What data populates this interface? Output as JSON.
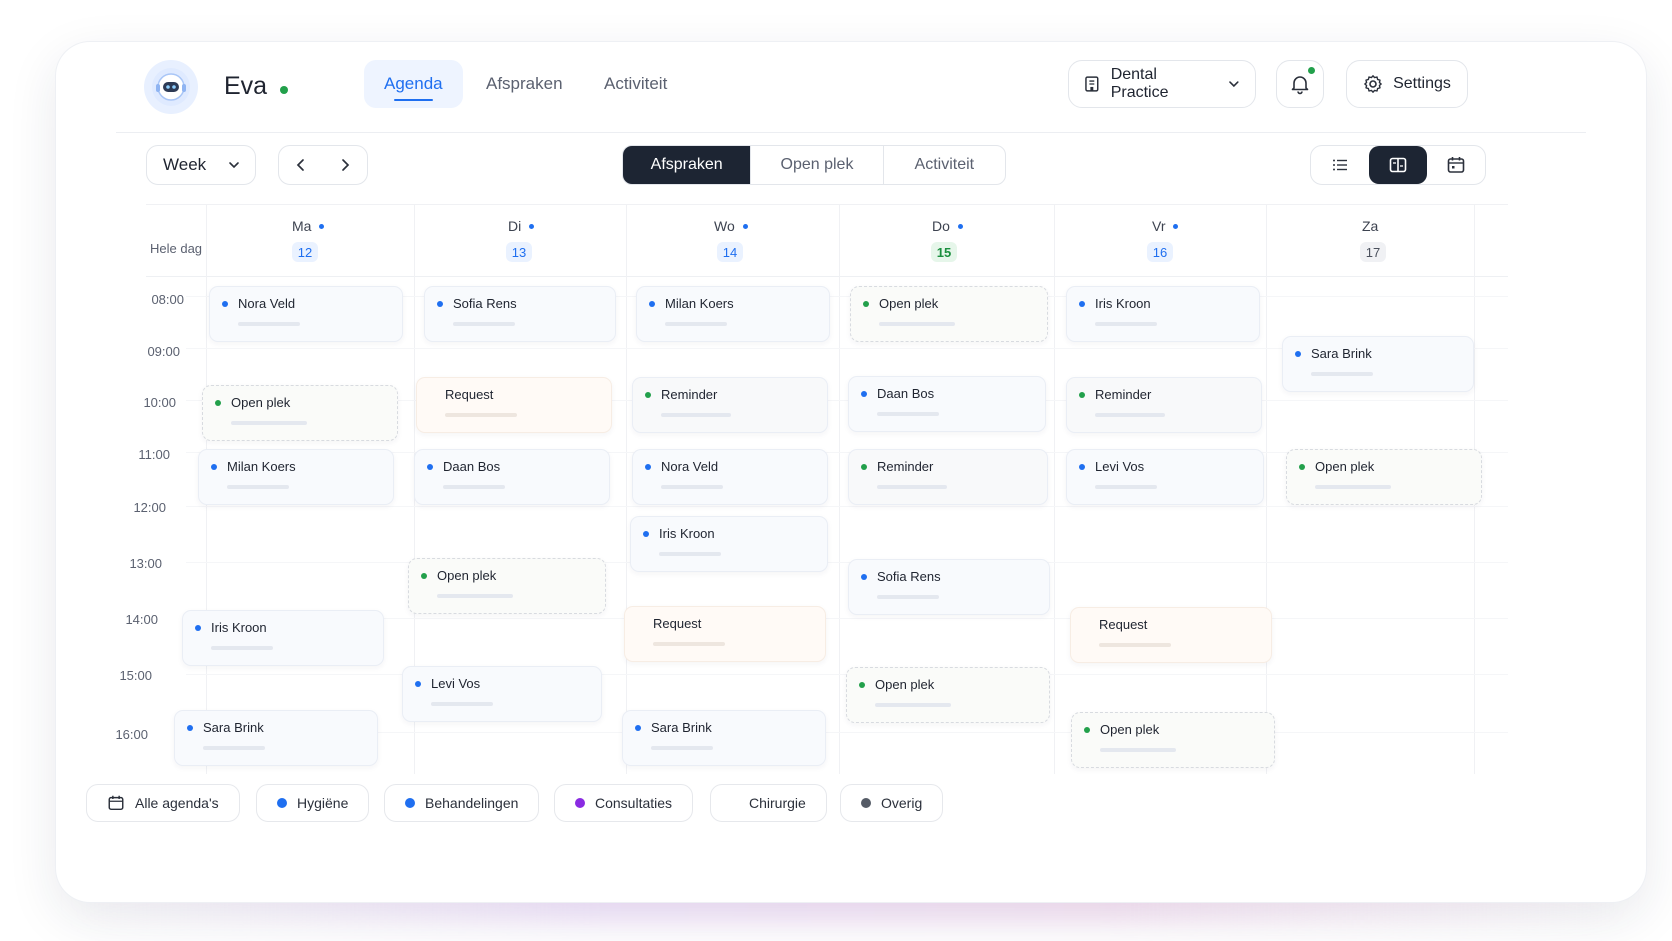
{
  "header": {
    "user_name": "Eva",
    "nav_tabs": [
      {
        "label": "Agenda",
        "active": true
      },
      {
        "label": "Afspraken",
        "active": false
      },
      {
        "label": "Activiteit",
        "active": false
      }
    ],
    "practice_label": "Dental Practice",
    "settings_label": "Settings"
  },
  "toolbar": {
    "range_select": "Week",
    "segments": [
      {
        "label": "Afspraken",
        "active": true
      },
      {
        "label": "Open plek",
        "active": false
      },
      {
        "label": "Activiteit",
        "active": false
      }
    ],
    "view_modes": [
      "list-icon",
      "split-view-icon",
      "calendar-icon"
    ]
  },
  "calendar": {
    "allday_label": "Hele dag",
    "days": [
      {
        "name": "Ma",
        "num": "12",
        "dot": true
      },
      {
        "name": "Di",
        "num": "13",
        "dot": true
      },
      {
        "name": "Wo",
        "num": "14",
        "dot": true
      },
      {
        "name": "Do",
        "num": "15",
        "dot": true,
        "today": true
      },
      {
        "name": "Vr",
        "num": "16",
        "dot": true
      },
      {
        "name": "Za",
        "num": "17",
        "dot": false
      }
    ],
    "times": [
      "08:00",
      "09:00",
      "10:00",
      "11:00",
      "12:00",
      "13:00",
      "14:00",
      "15:00",
      "16:00"
    ],
    "events": [
      {
        "label": "Nora Veld",
        "kind": "appointment"
      },
      {
        "label": "Open plek",
        "kind": "open"
      },
      {
        "label": "Milan Koers",
        "kind": "appointment"
      },
      {
        "label": "Iris Kroon",
        "kind": "appointment"
      },
      {
        "label": "Sara Brink",
        "kind": "appointment"
      },
      {
        "label": "Sofia Rens",
        "kind": "appointment"
      },
      {
        "label": "Request",
        "kind": "request"
      },
      {
        "label": "Daan Bos",
        "kind": "appointment"
      },
      {
        "label": "Open plek",
        "kind": "open"
      },
      {
        "label": "Levi Vos",
        "kind": "appointment"
      },
      {
        "label": "Milan Koers",
        "kind": "appointment"
      },
      {
        "label": "Reminder",
        "kind": "reminder"
      },
      {
        "label": "Nora Veld",
        "kind": "appointment"
      },
      {
        "label": "Iris Kroon",
        "kind": "appointment"
      },
      {
        "label": "Request",
        "kind": "request"
      },
      {
        "label": "Sara Brink",
        "kind": "appointment"
      },
      {
        "label": "Open plek",
        "kind": "open"
      },
      {
        "label": "Daan Bos",
        "kind": "appointment"
      },
      {
        "label": "Reminder",
        "kind": "reminder"
      },
      {
        "label": "Sofia Rens",
        "kind": "appointment"
      },
      {
        "label": "Open plek",
        "kind": "open"
      },
      {
        "label": "Iris Kroon",
        "kind": "appointment"
      },
      {
        "label": "Reminder",
        "kind": "reminder"
      },
      {
        "label": "Levi Vos",
        "kind": "appointment"
      },
      {
        "label": "Request",
        "kind": "request"
      },
      {
        "label": "Open plek",
        "kind": "open"
      },
      {
        "label": "Sara Brink",
        "kind": "appointment"
      },
      {
        "label": "Open plek",
        "kind": "open"
      }
    ]
  },
  "legend": [
    {
      "label": "Alle agenda's",
      "icon": "calendar-icon"
    },
    {
      "label": "Hygiëne",
      "color": "#1f6ff0"
    },
    {
      "label": "Behandelingen",
      "color": "#1f6ff0"
    },
    {
      "label": "Consultaties",
      "color": "#8a2be2"
    },
    {
      "label": "Chirurgie",
      "color": ""
    },
    {
      "label": "Overig",
      "color": "#555b66"
    }
  ],
  "colors": {
    "accent": "#1f6ff0",
    "dark": "#1d2533",
    "online": "#22a04b"
  }
}
